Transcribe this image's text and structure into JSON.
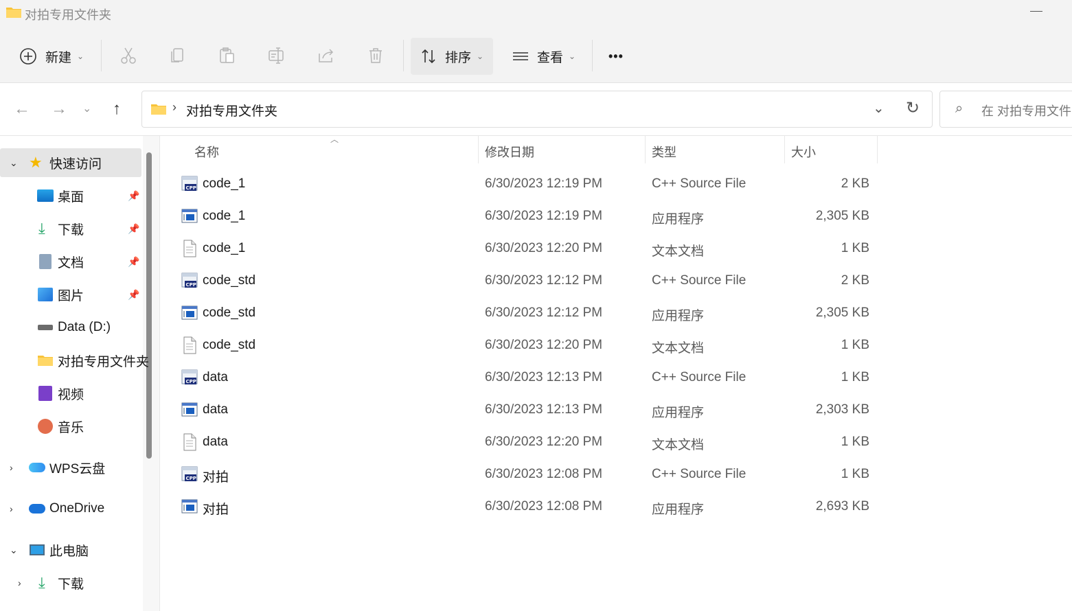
{
  "window": {
    "title": "对拍专用文件夹"
  },
  "toolbar": {
    "new_label": "新建",
    "sort_label": "排序",
    "view_label": "查看",
    "more_label": "•••"
  },
  "address": {
    "path": "对拍专用文件夹",
    "search_placeholder": "在 对拍专用文件"
  },
  "sidebar": {
    "quick_access": "快速访问",
    "items": [
      {
        "label": "桌面"
      },
      {
        "label": "下载"
      },
      {
        "label": "文档"
      },
      {
        "label": "图片"
      },
      {
        "label": "Data (D:)"
      },
      {
        "label": "对拍专用文件夹"
      },
      {
        "label": "视频"
      },
      {
        "label": "音乐"
      }
    ],
    "wps": "WPS云盘",
    "onedrive": "OneDrive",
    "this_pc": "此电脑",
    "pc_download": "下载"
  },
  "columns": {
    "name": "名称",
    "date": "修改日期",
    "type": "类型",
    "size": "大小"
  },
  "files": [
    {
      "name": "code_1",
      "date": "6/30/2023 12:19 PM",
      "type": "C++ Source File",
      "size": "2 KB",
      "icon": "cpp-file-icon"
    },
    {
      "name": "code_1",
      "date": "6/30/2023 12:19 PM",
      "type": "应用程序",
      "size": "2,305 KB",
      "icon": "exe-file-icon"
    },
    {
      "name": "code_1",
      "date": "6/30/2023 12:20 PM",
      "type": "文本文档",
      "size": "1 KB",
      "icon": "txt-file-icon"
    },
    {
      "name": "code_std",
      "date": "6/30/2023 12:12 PM",
      "type": "C++ Source File",
      "size": "2 KB",
      "icon": "cpp-file-icon"
    },
    {
      "name": "code_std",
      "date": "6/30/2023 12:12 PM",
      "type": "应用程序",
      "size": "2,305 KB",
      "icon": "exe-file-icon"
    },
    {
      "name": "code_std",
      "date": "6/30/2023 12:20 PM",
      "type": "文本文档",
      "size": "1 KB",
      "icon": "txt-file-icon"
    },
    {
      "name": "data",
      "date": "6/30/2023 12:13 PM",
      "type": "C++ Source File",
      "size": "1 KB",
      "icon": "cpp-file-icon"
    },
    {
      "name": "data",
      "date": "6/30/2023 12:13 PM",
      "type": "应用程序",
      "size": "2,303 KB",
      "icon": "exe-file-icon"
    },
    {
      "name": "data",
      "date": "6/30/2023 12:20 PM",
      "type": "文本文档",
      "size": "1 KB",
      "icon": "txt-file-icon"
    },
    {
      "name": "对拍",
      "date": "6/30/2023 12:08 PM",
      "type": "C++ Source File",
      "size": "1 KB",
      "icon": "cpp-file-icon"
    },
    {
      "name": "对拍",
      "date": "6/30/2023 12:08 PM",
      "type": "应用程序",
      "size": "2,693 KB",
      "icon": "exe-file-icon"
    }
  ]
}
